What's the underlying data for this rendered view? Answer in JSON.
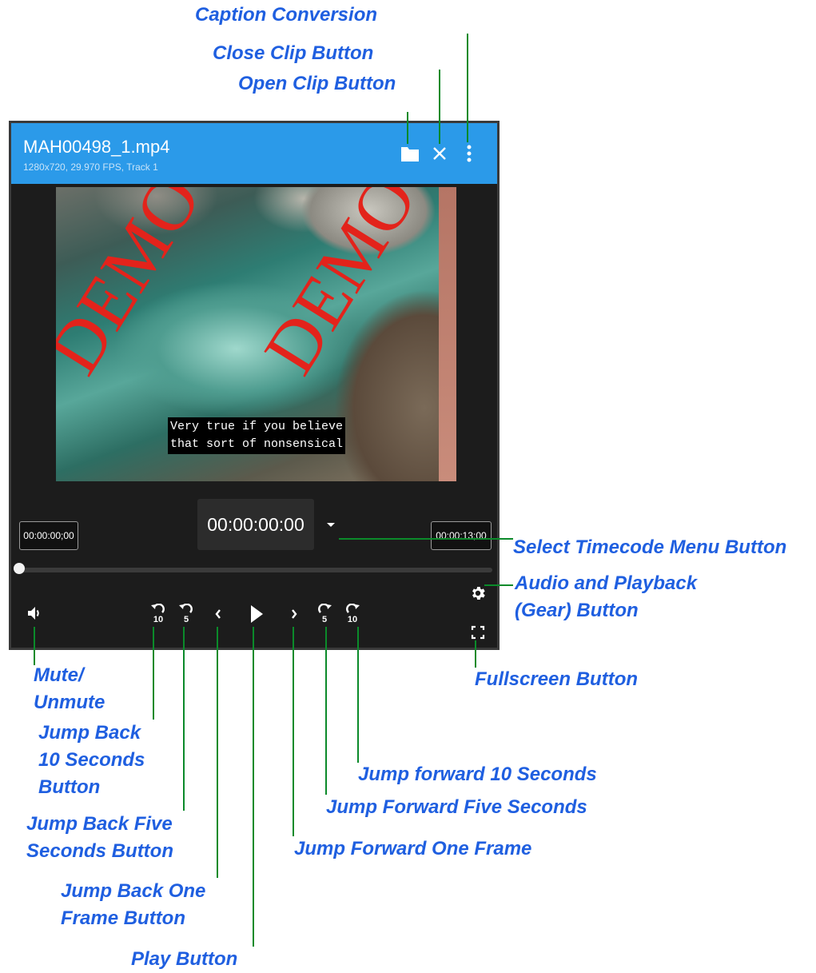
{
  "annotations": {
    "caption_conversion": "Caption Conversion",
    "close_clip": "Close Clip Button",
    "open_clip": "Open Clip Button",
    "select_timecode_menu": "Select Timecode Menu Button",
    "audio_playback_gear": "Audio and Playback\n(Gear) Button",
    "fullscreen": "Fullscreen Button",
    "mute_unmute": "Mute/\nUnmute",
    "jump_back_10": "Jump Back\n10 Seconds\nButton",
    "jump_back_five": "Jump Back Five\nSeconds Button",
    "jump_back_one_frame": "Jump Back One\nFrame Button",
    "play": "Play Button",
    "jump_forward_one_frame": "Jump Forward One Frame",
    "jump_forward_five": "Jump Forward Five Seconds",
    "jump_forward_10": "Jump forward 10 Seconds"
  },
  "player": {
    "file_name": "MAH00498_1.mp4",
    "file_info": "1280x720, 29.970 FPS, Track 1",
    "watermark": "DEMO",
    "caption_text": "Very true if you believe\nthat sort of nonsensical",
    "timecode_start": "00:00:00;00",
    "timecode_current": "00:00:00:00",
    "timecode_end": "00:00:13;00",
    "jump_back_10_label": "10",
    "jump_back_5_label": "5",
    "jump_forward_5_label": "5",
    "jump_forward_10_label": "10",
    "playhead_fraction": 0
  },
  "colors": {
    "header": "#2b9ae9",
    "annotation_text": "#1f5fe0",
    "leader_line": "#0b8a2a",
    "watermark": "#e3231b"
  },
  "icons": [
    "folder-icon",
    "close-icon",
    "more-vertical-icon",
    "dropdown-arrow-icon",
    "gear-icon",
    "fullscreen-icon",
    "volume-icon",
    "replay-10-icon",
    "replay-5-icon",
    "chevron-left-icon",
    "play-icon",
    "chevron-right-icon",
    "forward-5-icon",
    "forward-10-icon"
  ]
}
